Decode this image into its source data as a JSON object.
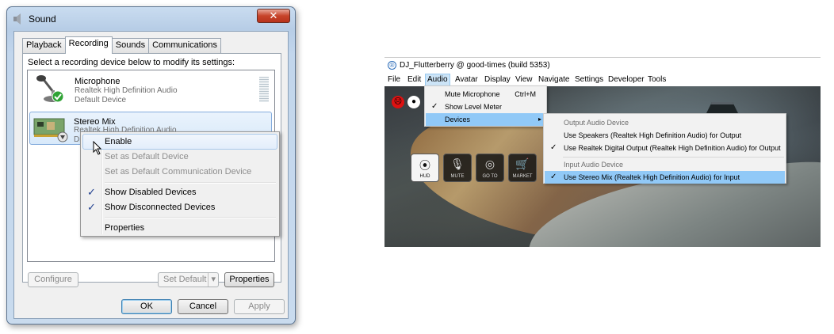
{
  "sound_dialog": {
    "title": "Sound",
    "close_label": "✕",
    "tabs": [
      {
        "label": "Playback"
      },
      {
        "label": "Recording"
      },
      {
        "label": "Sounds"
      },
      {
        "label": "Communications"
      }
    ],
    "instruction": "Select a recording device below to modify its settings:",
    "devices": [
      {
        "name": "Microphone",
        "driver": "Realtek High Definition Audio",
        "status": "Default Device"
      },
      {
        "name": "Stereo Mix",
        "driver": "Realtek High Definition Audio",
        "status": "Disabled"
      }
    ],
    "context_menu": [
      {
        "label": "Enable"
      },
      {
        "label": "Set as Default Device"
      },
      {
        "label": "Set as Default Communication Device"
      },
      {
        "label": "Show Disabled Devices",
        "check": "✓"
      },
      {
        "label": "Show Disconnected Devices",
        "check": "✓"
      },
      {
        "label": "Properties"
      }
    ],
    "buttons": {
      "configure": "Configure",
      "set_default": "Set Default",
      "set_default_arrow": "▾",
      "properties": "Properties",
      "ok": "OK",
      "cancel": "Cancel",
      "apply": "Apply"
    }
  },
  "app_window": {
    "logo": "®",
    "title": "DJ_Flutterberry @ good-times (build 5353)",
    "menubar": [
      {
        "label": "File"
      },
      {
        "label": "Edit"
      },
      {
        "label": "Audio"
      },
      {
        "label": "Avatar"
      },
      {
        "label": "Display"
      },
      {
        "label": "View"
      },
      {
        "label": "Navigate"
      },
      {
        "label": "Settings"
      },
      {
        "label": "Developer"
      },
      {
        "label": "Tools"
      }
    ],
    "audio_menu": [
      {
        "label": "Mute Microphone",
        "shortcut": "Ctrl+M"
      },
      {
        "label": "Show Level Meter",
        "check": "✓"
      },
      {
        "label": "Devices",
        "arrow": "▸"
      }
    ],
    "devices_submenu": {
      "output_header": "Output Audio Device",
      "outputs": [
        {
          "label": "Use Speakers (Realtek High Definition Audio) for Output"
        },
        {
          "label": "Use Realtek Digital Output (Realtek High Definition Audio) for Output",
          "check": "✓"
        }
      ],
      "input_header": "Input Audio Device",
      "inputs": [
        {
          "label": "Use Stereo Mix (Realtek High Definition Audio) for Input",
          "check": "✓"
        }
      ]
    },
    "hud_buttons": [
      {
        "label": "HUD",
        "icon": "⦿"
      },
      {
        "label": "MUTE",
        "icon": "🎙"
      },
      {
        "label": "GO TO",
        "icon": "◎"
      },
      {
        "label": "MARKET",
        "icon": "🛒"
      }
    ],
    "top_icons": [
      "☹",
      "●"
    ]
  }
}
